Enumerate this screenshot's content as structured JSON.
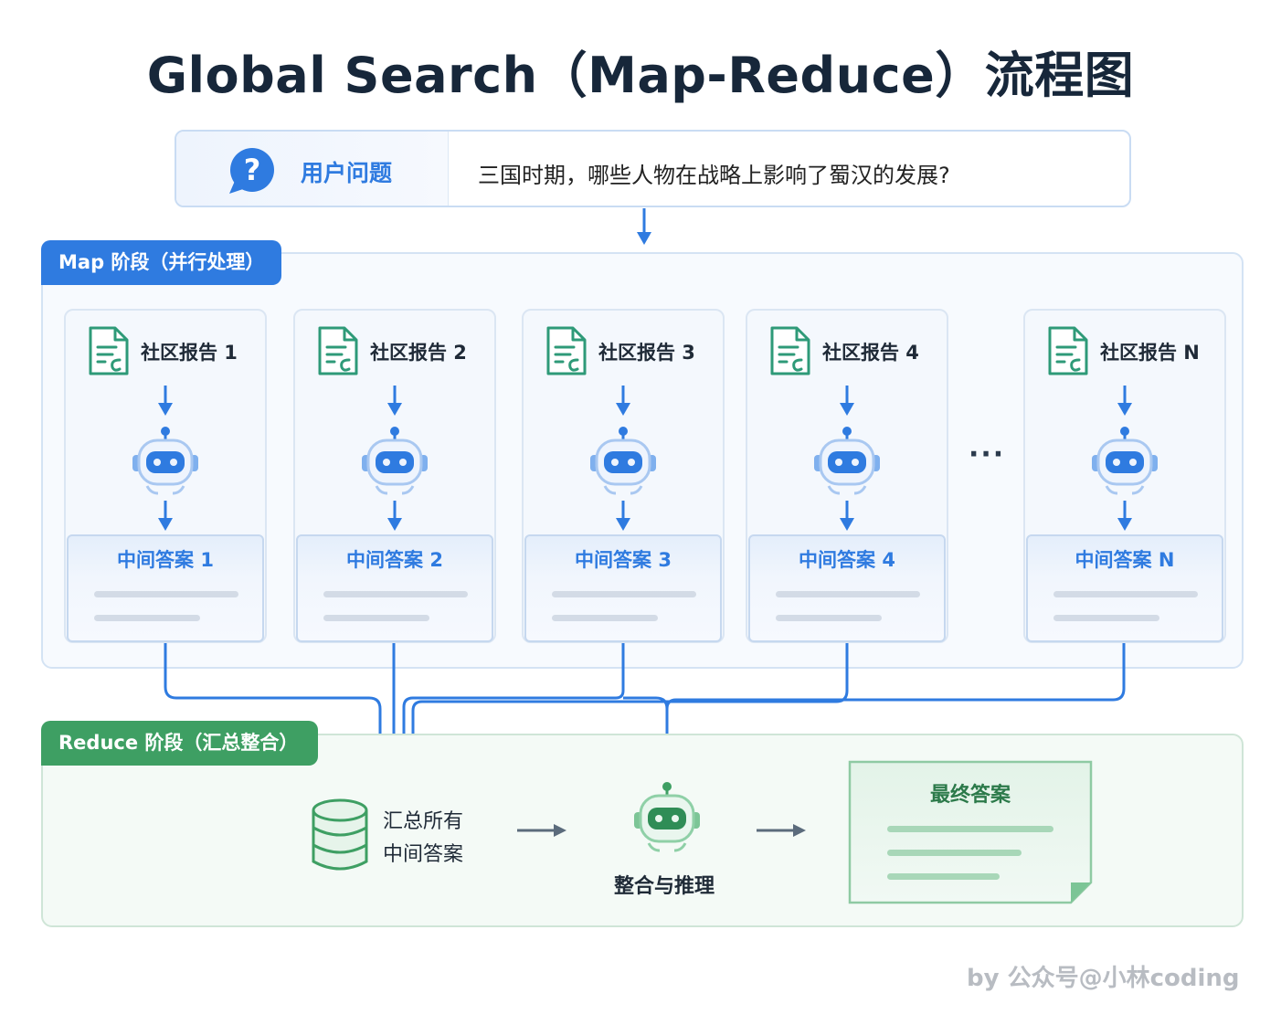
{
  "title": "Global Search（Map-Reduce）流程图",
  "question": {
    "label": "用户问题",
    "text": "三国时期，哪些人物在战略上影响了蜀汉的发展?"
  },
  "map_stage": {
    "tab_label": "Map 阶段（并行处理）",
    "columns": [
      {
        "report": "社区报告 1",
        "answer": "中间答案 1"
      },
      {
        "report": "社区报告 2",
        "answer": "中间答案 2"
      },
      {
        "report": "社区报告 3",
        "answer": "中间答案 3"
      },
      {
        "report": "社区报告 4",
        "answer": "中间答案 4"
      },
      {
        "report": "社区报告 N",
        "answer": "中间答案 N"
      }
    ],
    "ellipsis": "···"
  },
  "reduce_stage": {
    "tab_label": "Reduce 阶段（汇总整合）",
    "collect_line1": "汇总所有",
    "collect_line2": "中间答案",
    "merge_label": "整合与推理",
    "final_label": "最终答案"
  },
  "credit": "by 公众号@小林coding",
  "colors": {
    "map_blue": "#2f7be0",
    "reduce_green": "#3e9f63",
    "doc_teal": "#2e9a78",
    "connector_blue": "#2f7be0"
  },
  "icons": [
    "question-bubble-icon",
    "document-icon",
    "robot-icon",
    "database-icon",
    "arrow-down-icon",
    "arrow-right-icon"
  ]
}
